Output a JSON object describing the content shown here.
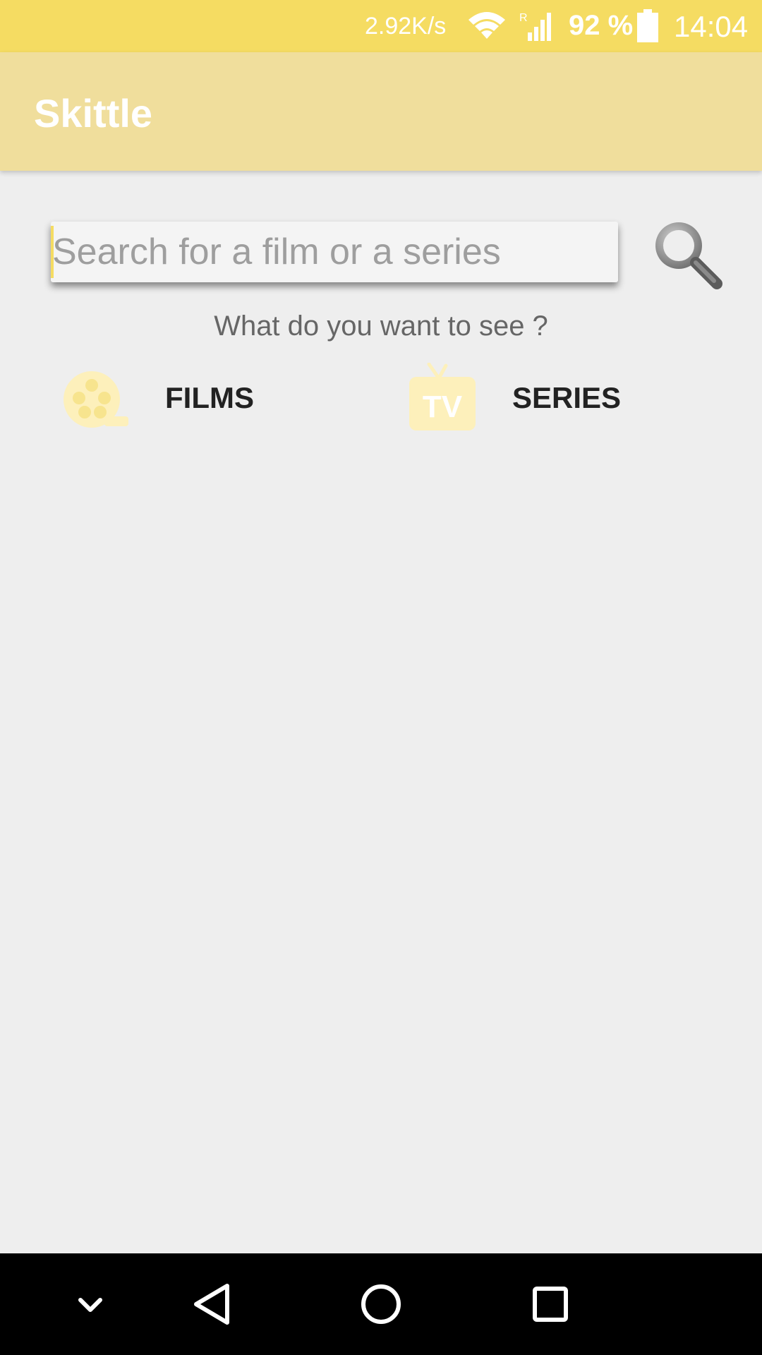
{
  "status_bar": {
    "net_speed": "2.92K/s",
    "signal_roaming": "R",
    "battery_percent": "92 %",
    "battery_level": 0.92,
    "time": "14:04",
    "background_color": "#f5dc62"
  },
  "app_bar": {
    "title": "Skittle",
    "background_color": "#f0de9c"
  },
  "search": {
    "placeholder": "Search for a film or a series",
    "value": "",
    "button_icon": "search-icon"
  },
  "prompt": "What do you want to see ?",
  "categories": [
    {
      "label": "FILMS",
      "icon": "film-reel-icon"
    },
    {
      "label": "SERIES",
      "icon": "tv-icon"
    }
  ],
  "nav_bar": {
    "buttons": [
      "hide-keyboard-icon",
      "back-icon",
      "home-icon",
      "recents-icon"
    ]
  }
}
